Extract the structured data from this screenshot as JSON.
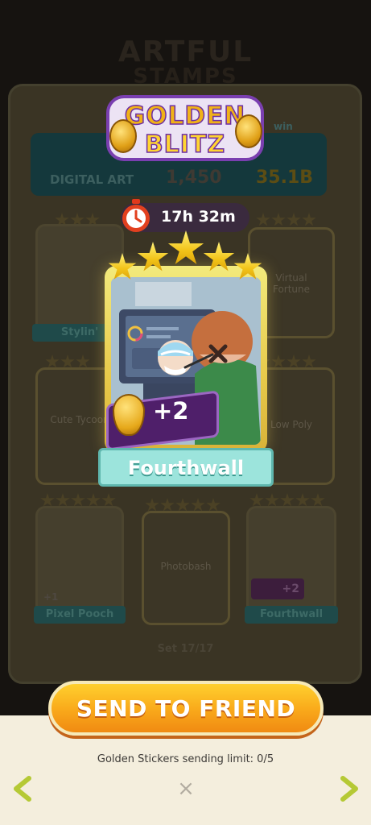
{
  "event": {
    "logo_line1": "GOLDEN",
    "logo_line2": "BLITZ",
    "timer": "17h 32m"
  },
  "featured_sticker": {
    "name": "Fourthwall",
    "bonus": "+2",
    "stars": 5
  },
  "album_background": {
    "title": "ARTFUL",
    "subtitle": "STAMPS",
    "header": {
      "category": "DIGITAL ART",
      "points": "1,450",
      "reward": "35.1B",
      "reward_label": "win"
    },
    "cards": [
      {
        "label": "Stylin'",
        "stars": 3,
        "collected": true
      },
      {
        "label": "Virtual Fortune",
        "stars": 4,
        "collected": false
      },
      {
        "label": "Cute Tycoon",
        "stars": 3,
        "collected": false
      },
      {
        "label": "Low Poly",
        "stars": 4,
        "collected": false
      },
      {
        "label": "Pixel Pooch",
        "stars": 5,
        "collected": true,
        "badge": "+1"
      },
      {
        "label": "Photobash",
        "stars": 5,
        "collected": false
      },
      {
        "label": "Fourthwall",
        "stars": 5,
        "collected": true,
        "badge": "+2"
      }
    ],
    "set_progress": "Set 17/17"
  },
  "actions": {
    "send_label": "SEND TO FRIEND",
    "limit_text": "Golden Stickers sending limit: 0/5",
    "prev_icon": "chevron-left-icon",
    "next_icon": "chevron-right-icon",
    "close_icon": "close-icon",
    "close_glyph": "×"
  },
  "colors": {
    "accent_orange": "#f9a81a",
    "gold": "#f2c318",
    "purple": "#6d2ea3",
    "teal_ribbon": "#9ce4dc",
    "sheet_bg": "#f4eedd",
    "arrow_green": "#b5c935"
  }
}
